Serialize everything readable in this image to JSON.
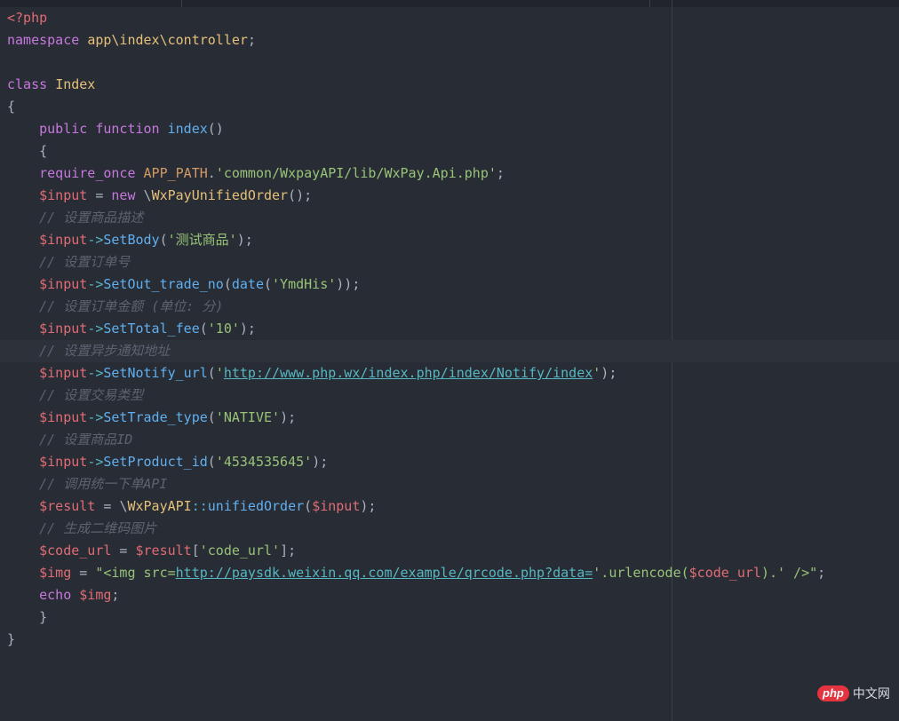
{
  "editor": {
    "lines": [
      [
        {
          "t": "<?php",
          "c": "kw2"
        }
      ],
      [
        {
          "t": "namespace ",
          "c": "kw"
        },
        {
          "t": "app\\index\\controller",
          "c": "cls"
        },
        {
          "t": ";",
          "c": "pun"
        }
      ],
      [],
      [
        {
          "t": "class ",
          "c": "kw"
        },
        {
          "t": "Index",
          "c": "cls"
        }
      ],
      [
        {
          "t": "{",
          "c": "pun"
        }
      ],
      [
        {
          "t": "    public ",
          "c": "kw"
        },
        {
          "t": "function ",
          "c": "kw"
        },
        {
          "t": "index",
          "c": "fn"
        },
        {
          "t": "()",
          "c": "pun"
        }
      ],
      [
        {
          "t": "    {",
          "c": "pun"
        }
      ],
      [
        {
          "t": "    require_once ",
          "c": "kw"
        },
        {
          "t": "APP_PATH",
          "c": "con"
        },
        {
          "t": ".",
          "c": "pun"
        },
        {
          "t": "'common/WxpayAPI/lib/WxPay.Api.php'",
          "c": "str"
        },
        {
          "t": ";",
          "c": "pun"
        }
      ],
      [
        {
          "t": "    $input",
          "c": "var"
        },
        {
          "t": " = ",
          "c": "pun"
        },
        {
          "t": "new ",
          "c": "kw"
        },
        {
          "t": "\\",
          "c": "pun"
        },
        {
          "t": "WxPayUnifiedOrder",
          "c": "cls"
        },
        {
          "t": "();",
          "c": "pun"
        }
      ],
      [
        {
          "t": "    // 设置商品描述",
          "c": "cm"
        }
      ],
      [
        {
          "t": "    $input",
          "c": "var"
        },
        {
          "t": "->",
          "c": "op"
        },
        {
          "t": "SetBody",
          "c": "fn"
        },
        {
          "t": "(",
          "c": "pun"
        },
        {
          "t": "'测试商品'",
          "c": "str"
        },
        {
          "t": ");",
          "c": "pun"
        }
      ],
      [
        {
          "t": "    // 设置订单号",
          "c": "cm"
        }
      ],
      [
        {
          "t": "    $input",
          "c": "var"
        },
        {
          "t": "->",
          "c": "op"
        },
        {
          "t": "SetOut_trade_no",
          "c": "fn"
        },
        {
          "t": "(",
          "c": "pun"
        },
        {
          "t": "date",
          "c": "fn"
        },
        {
          "t": "(",
          "c": "pun"
        },
        {
          "t": "'YmdHis'",
          "c": "str"
        },
        {
          "t": "));",
          "c": "pun"
        }
      ],
      [
        {
          "t": "    // 设置订单金额 (单位: 分)",
          "c": "cm"
        }
      ],
      [
        {
          "t": "    $input",
          "c": "var"
        },
        {
          "t": "->",
          "c": "op"
        },
        {
          "t": "SetTotal_fee",
          "c": "fn"
        },
        {
          "t": "(",
          "c": "pun"
        },
        {
          "t": "'10'",
          "c": "str"
        },
        {
          "t": ");",
          "c": "pun"
        }
      ],
      [
        {
          "t": "    // 设置异步通知地址",
          "c": "cm"
        }
      ],
      [
        {
          "t": "    $input",
          "c": "var"
        },
        {
          "t": "->",
          "c": "op"
        },
        {
          "t": "SetNotify_url",
          "c": "fn"
        },
        {
          "t": "(",
          "c": "pun"
        },
        {
          "t": "'",
          "c": "str"
        },
        {
          "t": "http://www.php.wx/index.php/index/Notify/index",
          "c": "url"
        },
        {
          "t": "'",
          "c": "str"
        },
        {
          "t": ");",
          "c": "pun"
        }
      ],
      [
        {
          "t": "    // 设置交易类型",
          "c": "cm"
        }
      ],
      [
        {
          "t": "    $input",
          "c": "var"
        },
        {
          "t": "->",
          "c": "op"
        },
        {
          "t": "SetTrade_type",
          "c": "fn"
        },
        {
          "t": "(",
          "c": "pun"
        },
        {
          "t": "'NATIVE'",
          "c": "str"
        },
        {
          "t": ");",
          "c": "pun"
        }
      ],
      [
        {
          "t": "    // 设置商品ID",
          "c": "cm"
        }
      ],
      [
        {
          "t": "    $input",
          "c": "var"
        },
        {
          "t": "->",
          "c": "op"
        },
        {
          "t": "SetProduct_id",
          "c": "fn"
        },
        {
          "t": "(",
          "c": "pun"
        },
        {
          "t": "'4534535645'",
          "c": "str"
        },
        {
          "t": ");",
          "c": "pun"
        }
      ],
      [
        {
          "t": "    // 调用统一下单API",
          "c": "cm"
        }
      ],
      [
        {
          "t": "    $result",
          "c": "var"
        },
        {
          "t": " = ",
          "c": "pun"
        },
        {
          "t": "\\",
          "c": "pun"
        },
        {
          "t": "WxPayAPI",
          "c": "cls"
        },
        {
          "t": "::",
          "c": "op"
        },
        {
          "t": "unifiedOrder",
          "c": "fn"
        },
        {
          "t": "(",
          "c": "pun"
        },
        {
          "t": "$input",
          "c": "var"
        },
        {
          "t": ");",
          "c": "pun"
        }
      ],
      [
        {
          "t": "    // 生成二维码图片",
          "c": "cm"
        }
      ],
      [
        {
          "t": "    $code_url",
          "c": "var"
        },
        {
          "t": " = ",
          "c": "pun"
        },
        {
          "t": "$result",
          "c": "var"
        },
        {
          "t": "[",
          "c": "pun"
        },
        {
          "t": "'code_url'",
          "c": "str"
        },
        {
          "t": "];",
          "c": "pun"
        }
      ],
      [
        {
          "t": "    $img",
          "c": "var"
        },
        {
          "t": " = ",
          "c": "pun"
        },
        {
          "t": "\"<img src=",
          "c": "str"
        },
        {
          "t": "http://paysdk.weixin.qq.com/example/qrcode.php?data=",
          "c": "url"
        },
        {
          "t": "'.urlencode(",
          "c": "str"
        },
        {
          "t": "$code_url",
          "c": "var"
        },
        {
          "t": ").' />\"",
          "c": "str"
        },
        {
          "t": ";",
          "c": "pun"
        }
      ],
      [
        {
          "t": "    echo ",
          "c": "kw"
        },
        {
          "t": "$img",
          "c": "var"
        },
        {
          "t": ";",
          "c": "pun"
        }
      ],
      [
        {
          "t": "    }",
          "c": "pun"
        }
      ],
      [
        {
          "t": "}",
          "c": "pun"
        }
      ]
    ],
    "cursor_line": 15
  },
  "watermark": {
    "logo": "php",
    "text": "中文网"
  },
  "colors": {
    "background": "#282c34",
    "keyword": "#c678dd",
    "string": "#98c379",
    "comment": "#5c6370",
    "variable": "#e06c75",
    "function": "#61afef",
    "class": "#e5c07b"
  }
}
